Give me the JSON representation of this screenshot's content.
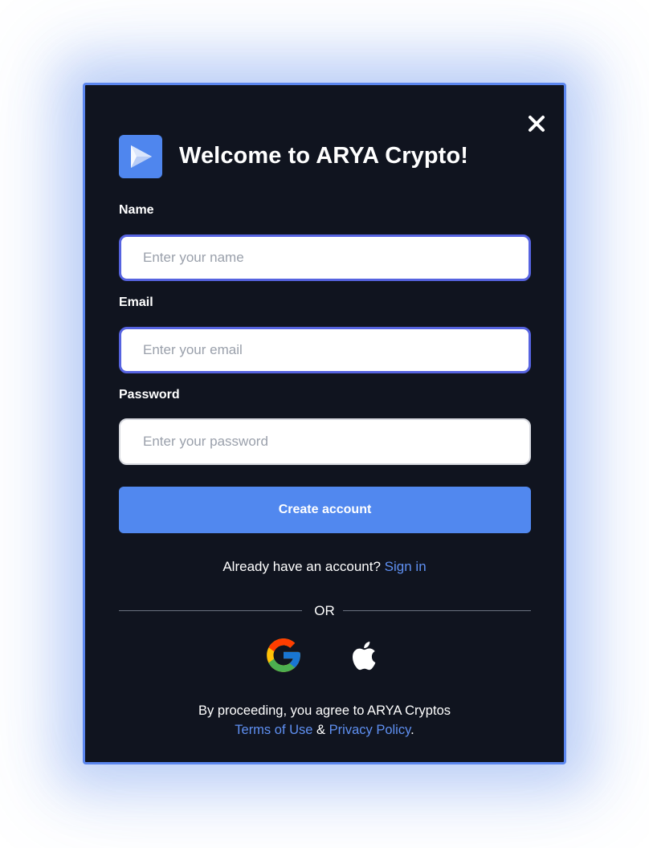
{
  "header": {
    "title": "Welcome to ARYA Crypto!",
    "logo_icon": "play-triangle-icon",
    "close_icon": "close-icon"
  },
  "form": {
    "name": {
      "label": "Name",
      "placeholder": "Enter your name",
      "value": ""
    },
    "email": {
      "label": "Email",
      "placeholder": "Enter your email",
      "value": ""
    },
    "password": {
      "label": "Password",
      "placeholder": "Enter your password",
      "value": ""
    },
    "submit_label": "Create account"
  },
  "signin": {
    "prompt": "Already have an account?",
    "link": "Sign in"
  },
  "divider": {
    "label": "OR"
  },
  "social": {
    "google_icon": "google-icon",
    "apple_icon": "apple-icon"
  },
  "legal": {
    "line1": "By proceeding, you agree to ARYA Cryptos",
    "terms": "Terms of Use",
    "amp": "&",
    "privacy": "Privacy Policy",
    "period": "."
  },
  "colors": {
    "modal_bg": "#10141f",
    "accent": "#5188ef",
    "link": "#5f90f2",
    "focus_border": "#5663e0"
  }
}
